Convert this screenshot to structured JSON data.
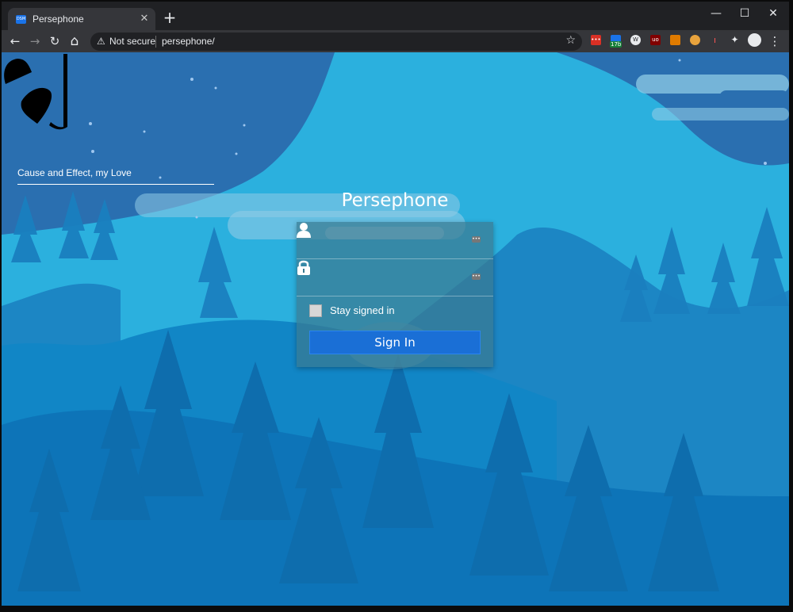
{
  "browser": {
    "tab_title": "Persephone",
    "favicon_text": "DSM",
    "security_label": "Not secure",
    "url": "persephone/",
    "close_glyph": "✕",
    "new_tab_glyph": "+",
    "minimize_glyph": "—",
    "maximize_glyph": "☐",
    "window_close_glyph": "✕",
    "back_glyph": "←",
    "forward_glyph": "→",
    "reload_glyph": "↻",
    "home_glyph": "⌂",
    "star_glyph": "☆",
    "menu_glyph": "⋮",
    "extensions": [
      {
        "icon": "red-dots-extension-icon",
        "color": "#d93025"
      },
      {
        "icon": "calendar-extension-icon",
        "color": "#1a73e8",
        "badge": "17b"
      },
      {
        "icon": "wordpress-extension-icon",
        "color": "#3c3c3c"
      },
      {
        "icon": "ublock-extension-icon",
        "color": "#800000"
      },
      {
        "icon": "orange-extension-icon",
        "color": "#e07b00"
      },
      {
        "icon": "colorful-extension-icon",
        "color": "#e8a33d"
      },
      {
        "icon": "red-extension-icon",
        "color": "#c5221f"
      },
      {
        "icon": "puzzle-extensions-icon",
        "color": "#e8eaed"
      },
      {
        "icon": "profile-avatar-icon",
        "color": "#e8eaed"
      }
    ]
  },
  "login": {
    "tagline": "Cause and Effect, my Love",
    "title": "Persephone",
    "username_value": "",
    "password_value": "",
    "stay_signed_in_label": "Stay signed in",
    "sign_in_label": "Sign In"
  },
  "colors": {
    "sky": "#2bb0de",
    "night_sky": "#2a6fb0",
    "hill_dark": "#0d74b8",
    "button": "#1a6fd6"
  }
}
